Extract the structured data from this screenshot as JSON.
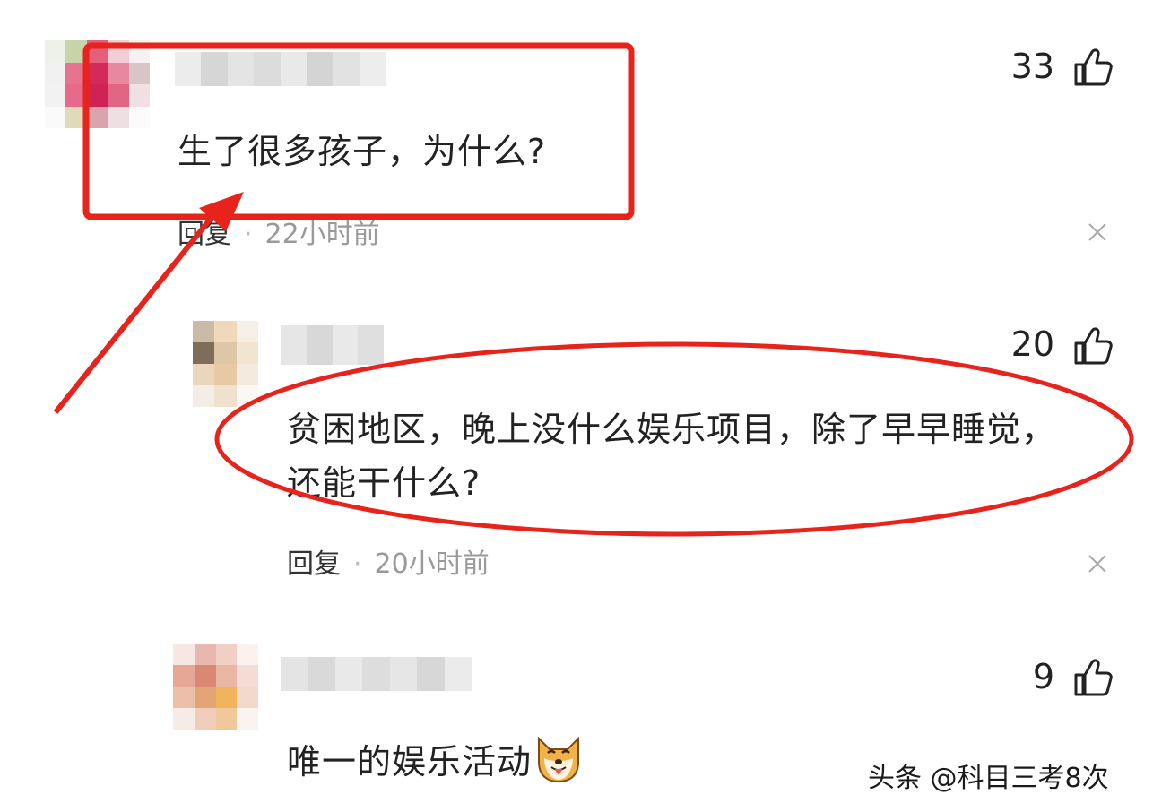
{
  "comments": [
    {
      "text": "生了很多孩子，为什么?",
      "like_count": "33",
      "reply_label": "回复",
      "time": "22小时前"
    },
    {
      "text_line1": "贫困地区，晚上没什么娱乐项目，除了早早睡觉，",
      "text_line2": "还能干什么?",
      "like_count": "20",
      "reply_label": "回复",
      "time": "20小时前"
    },
    {
      "text": "唯一的娱乐活动",
      "like_count": "9"
    }
  ],
  "watermark": "头条 @科目三考8次",
  "annotation_colors": {
    "highlight": "#e8231c"
  },
  "icons": {
    "like": "thumbs-up-icon",
    "close": "close-icon",
    "emoji": "shiba-dog-emoji"
  }
}
